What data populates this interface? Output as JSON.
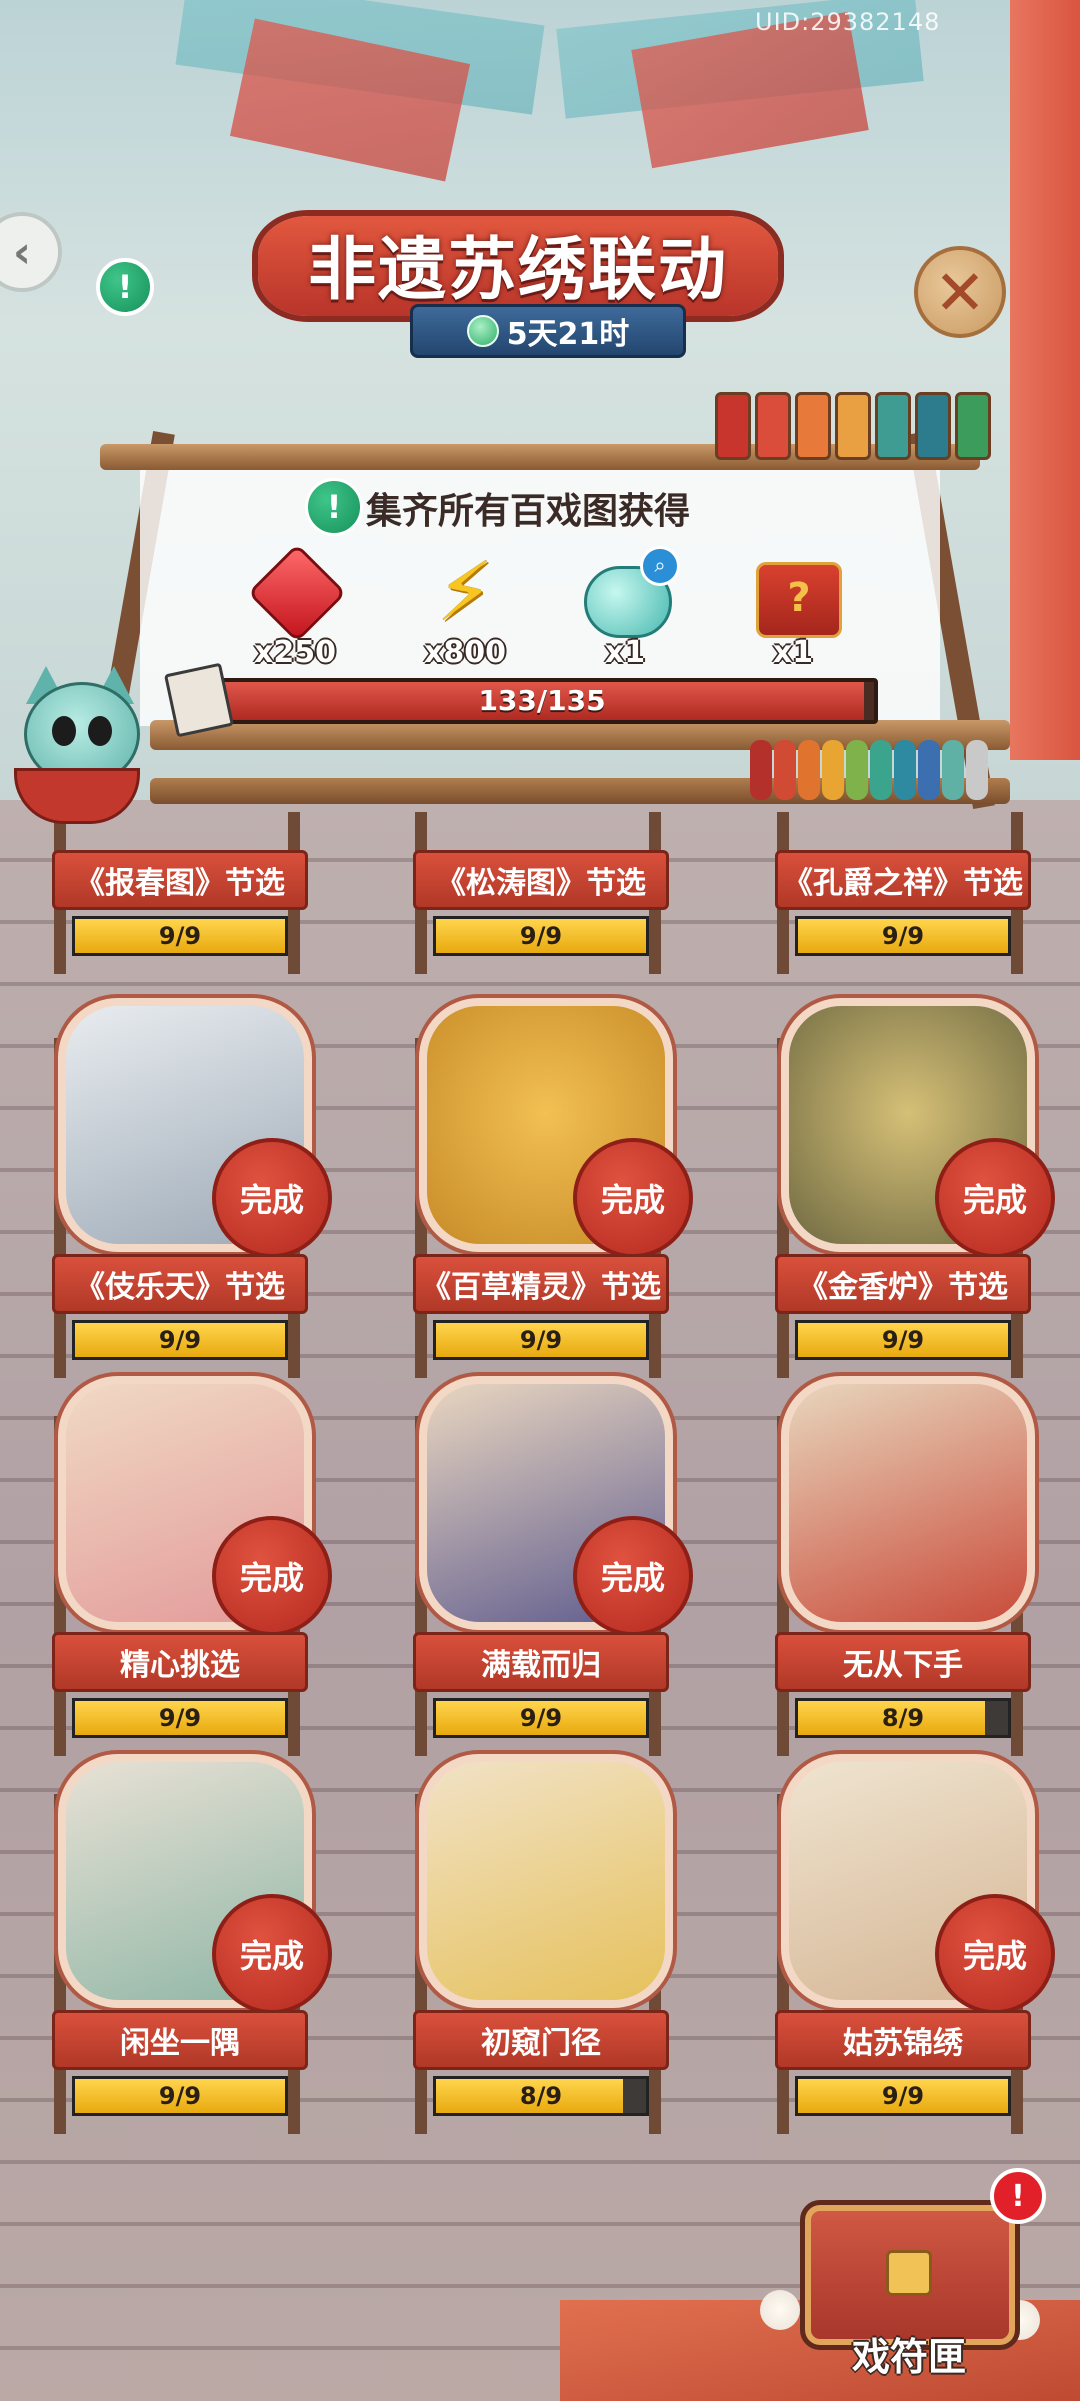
{
  "uid": "UID:29382148",
  "header": {
    "title": "非遗苏绣联动",
    "timer": "5天21时"
  },
  "goal": {
    "text": "集齐所有百戏图获得",
    "rewards": [
      {
        "icon": "ruby-gem-icon",
        "qty": "x250"
      },
      {
        "icon": "lightning-bolt-icon",
        "qty": "x800"
      },
      {
        "icon": "jade-orb-icon",
        "qty": "x1"
      },
      {
        "icon": "mystery-chest-icon",
        "qty": "x1"
      }
    ],
    "progress_text": "133/135",
    "progress_fraction": 0.985
  },
  "cards": [
    {
      "label": "《报春图》节选",
      "progress": "9/9",
      "fraction": 1.0,
      "done": true
    },
    {
      "label": "《松涛图》节选",
      "progress": "9/9",
      "fraction": 1.0,
      "done": true
    },
    {
      "label": "《孔爵之祥》节选",
      "progress": "9/9",
      "fraction": 1.0,
      "done": true
    },
    {
      "label": "《伎乐天》节选",
      "progress": "9/9",
      "fraction": 1.0,
      "done": true,
      "done_text": "完成"
    },
    {
      "label": "《百草精灵》节选",
      "progress": "9/9",
      "fraction": 1.0,
      "done": true,
      "done_text": "完成"
    },
    {
      "label": "《金香炉》节选",
      "progress": "9/9",
      "fraction": 1.0,
      "done": true,
      "done_text": "完成"
    },
    {
      "label": "精心挑选",
      "progress": "9/9",
      "fraction": 1.0,
      "done": true,
      "done_text": "完成"
    },
    {
      "label": "满载而归",
      "progress": "9/9",
      "fraction": 1.0,
      "done": true,
      "done_text": "完成"
    },
    {
      "label": "无从下手",
      "progress": "8/9",
      "fraction": 0.889,
      "done": false
    },
    {
      "label": "闲坐一隅",
      "progress": "9/9",
      "fraction": 1.0,
      "done": true,
      "done_text": "完成"
    },
    {
      "label": "初窥门径",
      "progress": "8/9",
      "fraction": 0.889,
      "done": false
    },
    {
      "label": "姑苏锦绣",
      "progress": "9/9",
      "fraction": 1.0,
      "done": true,
      "done_text": "完成"
    }
  ],
  "chest": {
    "label": "戏符匣",
    "alert": "!"
  },
  "colors": {
    "accent_red": "#c9463e",
    "progress_yellow": "#ffd54d",
    "info_green": "#16915a"
  }
}
